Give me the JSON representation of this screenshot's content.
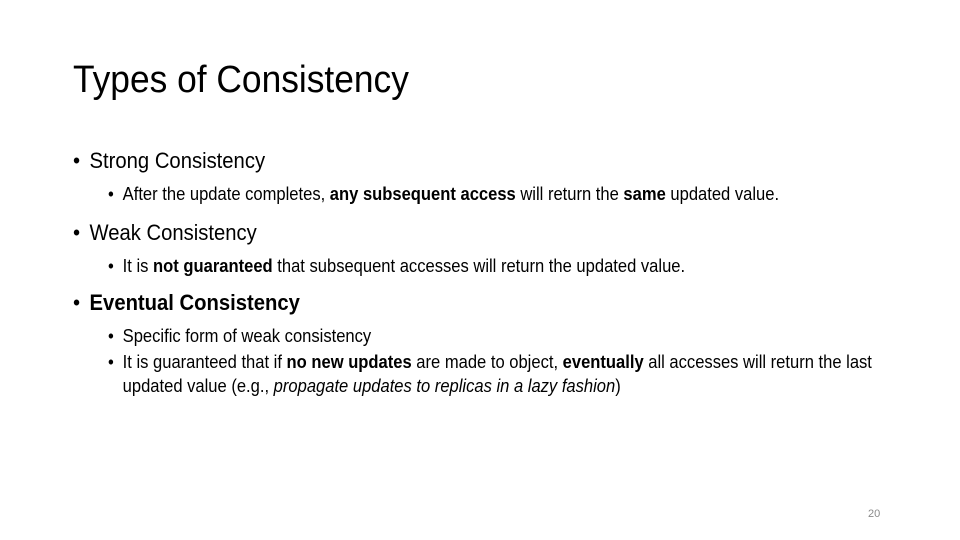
{
  "slide": {
    "title": "Types of Consistency",
    "bullet_glyph": "•",
    "items": [
      {
        "heading": "Strong Consistency",
        "sub": [
          {
            "parts": [
              {
                "text": "After the update completes, ",
                "style": "normal"
              },
              {
                "text": "any subsequent access",
                "style": "bold"
              },
              {
                "text": " will return the ",
                "style": "normal"
              },
              {
                "text": "same",
                "style": "bold"
              },
              {
                "text": " updated value.",
                "style": "normal"
              }
            ]
          }
        ]
      },
      {
        "heading": "Weak Consistency",
        "sub": [
          {
            "parts": [
              {
                "text": "It is ",
                "style": "normal"
              },
              {
                "text": "not guaranteed",
                "style": "bold"
              },
              {
                "text": " that subsequent accesses will return the updated value.",
                "style": "normal"
              }
            ]
          }
        ]
      },
      {
        "heading": "Eventual Consistency",
        "heading_bold": true,
        "sub": [
          {
            "parts": [
              {
                "text": "Specific form of weak consistency",
                "style": "normal"
              }
            ]
          },
          {
            "parts": [
              {
                "text": "It is guaranteed that if ",
                "style": "normal"
              },
              {
                "text": "no new updates",
                "style": "bold"
              },
              {
                "text": " are made to object, ",
                "style": "normal"
              },
              {
                "text": "eventually",
                "style": "bold"
              },
              {
                "text": " all accesses will return the last updated value (e.g., ",
                "style": "normal"
              },
              {
                "text": "propagate updates to replicas in a lazy fashion",
                "style": "italic"
              },
              {
                "text": ")",
                "style": "normal"
              }
            ]
          }
        ]
      }
    ],
    "page_number": "20"
  }
}
